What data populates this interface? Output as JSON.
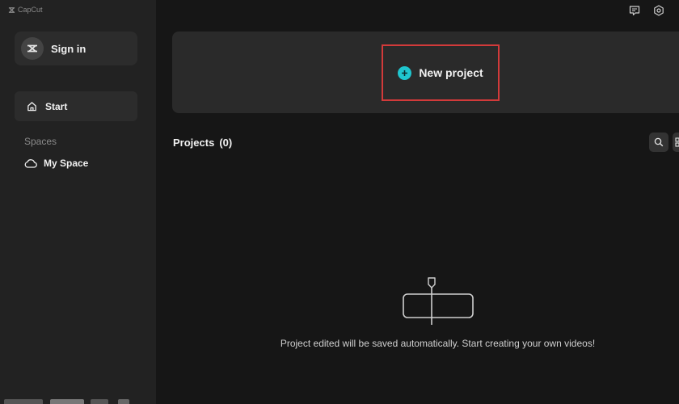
{
  "app": {
    "title": "CapCut"
  },
  "sidebar": {
    "sign_in": "Sign in",
    "start": "Start",
    "spaces_heading": "Spaces",
    "my_space": "My Space"
  },
  "main": {
    "new_project": "New project",
    "projects_label": "Projects",
    "projects_count": "(0)",
    "empty_message": "Project edited will be saved automatically. Start creating your own videos!"
  },
  "colors": {
    "accent": "#1fc6cf",
    "highlight": "#d23a3a"
  },
  "icons": [
    "capcut-logo-icon",
    "feedback-icon",
    "settings-icon",
    "home-icon",
    "cloud-icon",
    "plus-icon",
    "search-icon",
    "grid-view-icon"
  ]
}
